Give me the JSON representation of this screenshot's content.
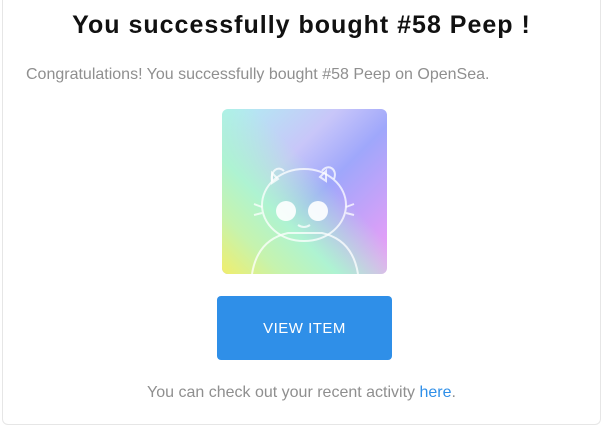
{
  "email": {
    "title": "You successfully bought #58 Peep !",
    "subtitle": "Congratulations! You successfully bought #58 Peep on OpenSea.",
    "nft_image": {
      "icon": "peep-creature-icon",
      "colors": [
        "#aef1f1",
        "#c8c6f9",
        "#9fa7fb",
        "#f59cf6",
        "#f1ee6c",
        "#c6f3ae"
      ]
    },
    "view_button_label": "VIEW ITEM",
    "footer_prefix": "You can check out your recent activity ",
    "footer_link": "here",
    "footer_suffix": ".",
    "accent_color": "#2f8fe8"
  }
}
